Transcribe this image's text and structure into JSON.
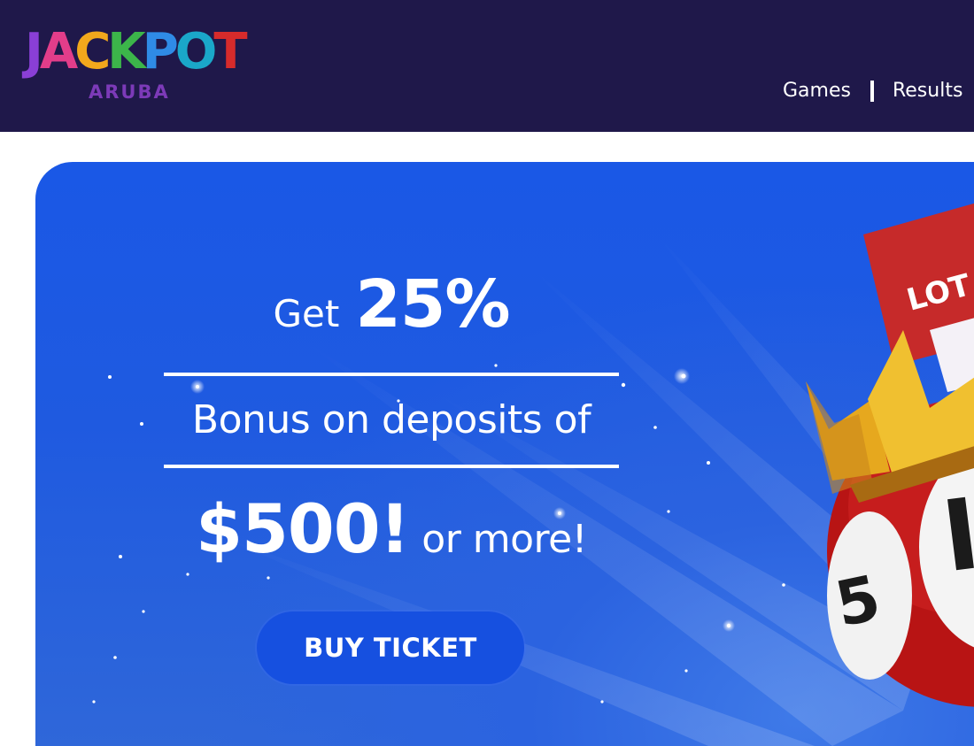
{
  "header": {
    "logo": {
      "word": "JACKPOT",
      "sub": "ARUBA",
      "letter_colors": [
        "#8a3fd6",
        "#e23d8a",
        "#f2a81c",
        "#3cb54a",
        "#2f8be6",
        "#1aa7c9",
        "#d62b2b"
      ]
    },
    "nav": [
      {
        "label": "Games"
      },
      {
        "label": "Results"
      }
    ],
    "background": "#1f184a"
  },
  "hero": {
    "line1_get": "Get",
    "line1_percent": "25%",
    "line2": "Bonus on deposits of",
    "line3_amount": "$500!",
    "line3_suffix": "or more!",
    "cta_label": "BUY TICKET",
    "ticket_text": "LOT",
    "ball_text": "5",
    "colors": {
      "banner_blue": "#1a58e6",
      "cta_blue": "#1650e0",
      "ticket_red": "#c62a2a",
      "crown_gold": "#f0b82a",
      "ball_red": "#c01818"
    }
  }
}
